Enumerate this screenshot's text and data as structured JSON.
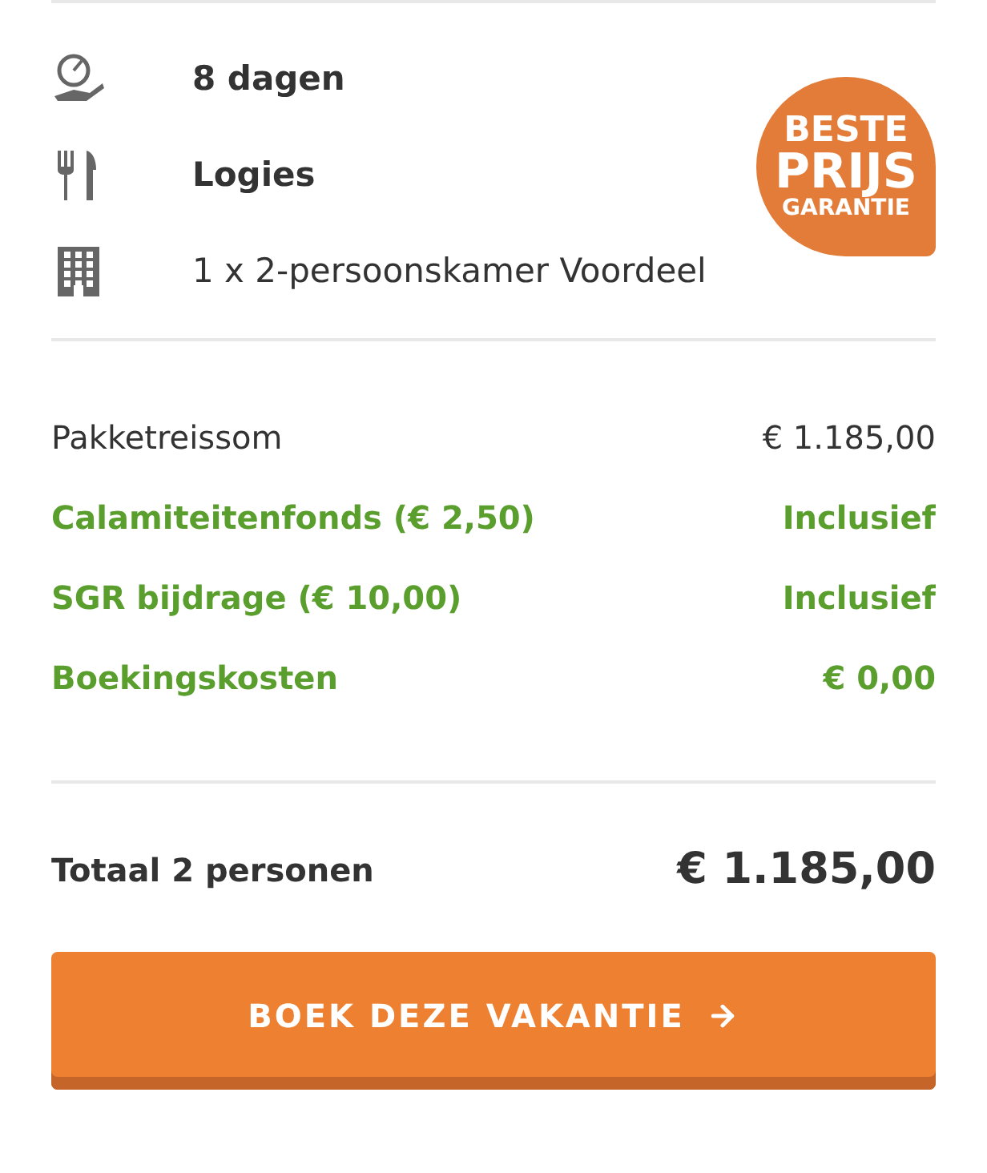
{
  "features": [
    {
      "kind": "duration",
      "text": "8 dagen",
      "bold": true
    },
    {
      "kind": "meals",
      "text": "Logies",
      "bold": true
    },
    {
      "kind": "room",
      "text": "1 x 2-persoonskamer Voordeel",
      "bold": false
    }
  ],
  "badge": {
    "lines": [
      "BESTE",
      "PRIJS",
      "GARANTIE"
    ]
  },
  "prices": [
    {
      "label": "Pakketreissom",
      "amount": "€ 1.185,00",
      "highlight": false
    },
    {
      "label": "Calamiteitenfonds (€ 2,50)",
      "amount": "Inclusief",
      "highlight": true
    },
    {
      "label": "SGR bijdrage (€ 10,00)",
      "amount": "Inclusief",
      "highlight": true
    },
    {
      "label": "Boekingskosten",
      "amount": "€ 0,00",
      "highlight": true
    }
  ],
  "total": {
    "label": "Totaal 2 personen",
    "amount": "€ 1.185,00"
  },
  "button": {
    "label": "BOEK DEZE VAKANTIE"
  }
}
